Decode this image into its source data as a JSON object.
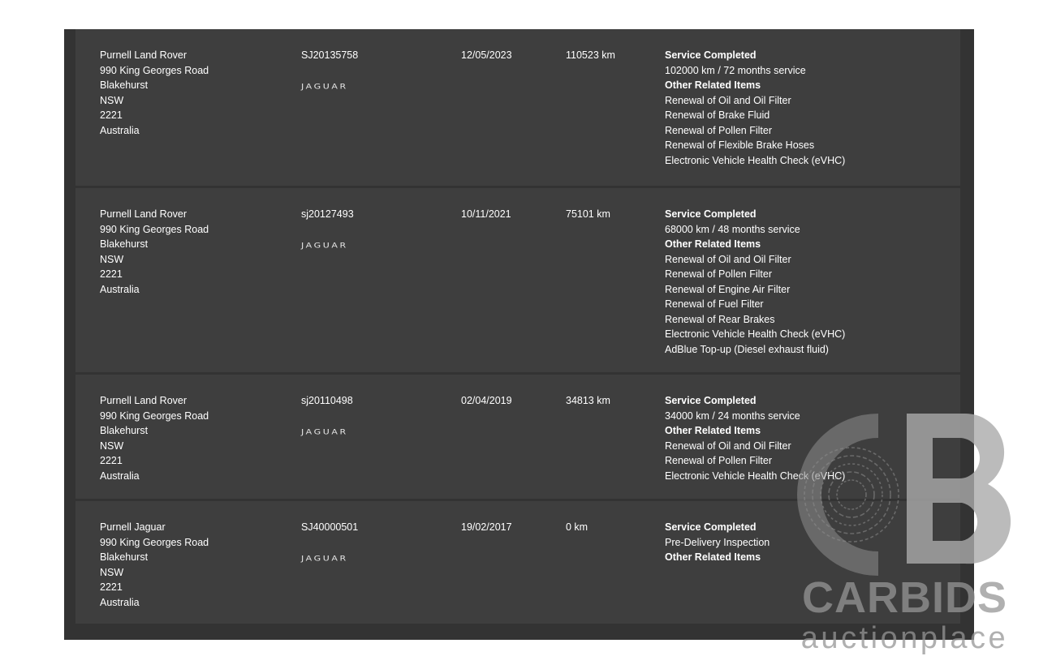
{
  "brand_logo_text": "JAGUAR",
  "records": [
    {
      "dealer_lines": [
        "Purnell Land Rover",
        "990 King Georges Road",
        "Blakehurst",
        "NSW",
        "2221",
        "Australia"
      ],
      "vin": "SJ20135758",
      "date": "12/05/2023",
      "odometer": "110523 km",
      "status": "Service Completed",
      "service": "102000 km / 72 months service",
      "related_heading": "Other Related Items",
      "related_items": [
        "Renewal of Oil and Oil Filter",
        "Renewal of Brake Fluid",
        "Renewal of Pollen Filter",
        "Renewal of Flexible Brake Hoses",
        "Electronic Vehicle Health Check (eVHC)"
      ]
    },
    {
      "dealer_lines": [
        "Purnell Land Rover",
        "990 King Georges Road",
        "Blakehurst",
        "NSW",
        "2221",
        "Australia"
      ],
      "vin": "sj20127493",
      "date": "10/11/2021",
      "odometer": "75101 km",
      "status": "Service Completed",
      "service": "68000 km / 48 months service",
      "related_heading": "Other Related Items",
      "related_items": [
        "Renewal of Oil and Oil Filter",
        "Renewal of Pollen Filter",
        "Renewal of Engine Air Filter",
        "Renewal of Fuel Filter",
        "Renewal of Rear Brakes",
        "Electronic Vehicle Health Check (eVHC)",
        "AdBlue Top-up (Diesel exhaust fluid)"
      ]
    },
    {
      "dealer_lines": [
        "Purnell Land Rover",
        "990 King Georges Road",
        "Blakehurst",
        "NSW",
        "2221",
        "Australia"
      ],
      "vin": "sj20110498",
      "date": "02/04/2019",
      "odometer": "34813 km",
      "status": "Service Completed",
      "service": "34000 km / 24 months service",
      "related_heading": "Other Related Items",
      "related_items": [
        "Renewal of Oil and Oil Filter",
        "Renewal of Pollen Filter",
        "Electronic Vehicle Health Check (eVHC)"
      ]
    },
    {
      "dealer_lines": [
        "Purnell Jaguar",
        "990 King Georges Road",
        "Blakehurst",
        "NSW",
        "2221",
        "Australia"
      ],
      "vin": "SJ40000501",
      "date": "19/02/2017",
      "odometer": "0 km",
      "status": "Service Completed",
      "service": "Pre-Delivery Inspection",
      "related_heading": "Other Related Items",
      "related_items": []
    }
  ],
  "watermark": {
    "line1": "CARBIDS",
    "line2": "auctionplace"
  },
  "colors": {
    "panel": "#333333",
    "row": "#3e3e3e",
    "text": "#ffffff",
    "watermark": "#969696"
  }
}
